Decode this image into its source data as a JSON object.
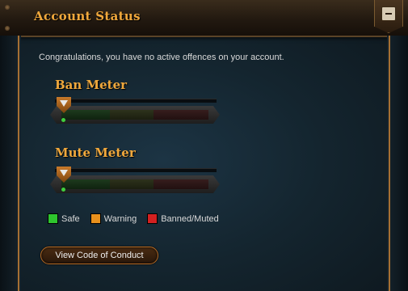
{
  "header": {
    "title": "Account Status"
  },
  "intro_text": "Congratulations, you have no active offences on your account.",
  "meters": [
    {
      "title": "Ban Meter",
      "level": 0
    },
    {
      "title": "Mute Meter",
      "level": 0
    }
  ],
  "legend": {
    "items": [
      {
        "label": "Safe",
        "color": "#2ec52e"
      },
      {
        "label": "Warning",
        "color": "#e8901c"
      },
      {
        "label": "Banned/Muted",
        "color": "#d42020"
      }
    ]
  },
  "actions": {
    "code_of_conduct_label": "View Code of Conduct"
  },
  "colors": {
    "accent": "#f0a83c",
    "frame": "#c98336"
  },
  "icons": {
    "collapse": "minus-icon"
  }
}
